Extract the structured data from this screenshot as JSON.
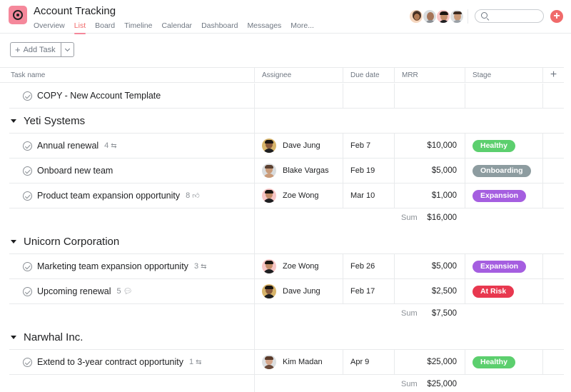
{
  "project": {
    "title": "Account Tracking",
    "icon": "target-icon",
    "brand_color": "#f5889b"
  },
  "tabs": [
    {
      "label": "Overview",
      "active": false
    },
    {
      "label": "List",
      "active": true
    },
    {
      "label": "Board",
      "active": false
    },
    {
      "label": "Timeline",
      "active": false
    },
    {
      "label": "Calendar",
      "active": false
    },
    {
      "label": "Dashboard",
      "active": false
    },
    {
      "label": "Messages",
      "active": false
    },
    {
      "label": "More...",
      "active": false
    }
  ],
  "header": {
    "members": [
      "member-1",
      "member-2",
      "member-3",
      "member-4"
    ],
    "search_placeholder": "",
    "add_icon": "plus-icon"
  },
  "toolbar": {
    "add_task_label": "Add Task",
    "add_task_icon": "+"
  },
  "columns": {
    "task_name": "Task name",
    "assignee": "Assignee",
    "due_date": "Due date",
    "mrr": "MRR",
    "stage": "Stage",
    "add_column": "+"
  },
  "template_task": {
    "name": "COPY - New Account Template"
  },
  "stage_colors": {
    "Healthy": "#5ccf6e",
    "Onboarding": "#8d9ca0",
    "Expansion": "#a55ee0",
    "At Risk": "#e8384f"
  },
  "sections": [
    {
      "name": "Yeti Systems",
      "tasks": [
        {
          "name": "Annual renewal",
          "meta_count": "4",
          "meta_icon": "subtask-icon",
          "assignee": "Dave Jung",
          "due": "Feb 7",
          "mrr": "$10,000",
          "stage": "Healthy"
        },
        {
          "name": "Onboard new team",
          "meta_count": "",
          "meta_icon": "",
          "assignee": "Blake Vargas",
          "due": "Feb 19",
          "mrr": "$5,000",
          "stage": "Onboarding"
        },
        {
          "name": "Product team expansion opportunity",
          "meta_count": "8",
          "meta_icon": "like-icon",
          "assignee": "Zoe Wong",
          "due": "Mar 10",
          "mrr": "$1,000",
          "stage": "Expansion"
        }
      ],
      "sum_label": "Sum",
      "sum": "$16,000"
    },
    {
      "name": "Unicorn Corporation",
      "tasks": [
        {
          "name": "Marketing team expansion opportunity",
          "meta_count": "3",
          "meta_icon": "subtask-icon",
          "assignee": "Zoe Wong",
          "due": "Feb 26",
          "mrr": "$5,000",
          "stage": "Expansion"
        },
        {
          "name": "Upcoming renewal",
          "meta_count": "5",
          "meta_icon": "comment-icon",
          "assignee": "Dave Jung",
          "due": "Feb 17",
          "mrr": "$2,500",
          "stage": "At Risk"
        }
      ],
      "sum_label": "Sum",
      "sum": "$7,500"
    },
    {
      "name": "Narwhal Inc.",
      "tasks": [
        {
          "name": "Extend to 3-year contract opportunity",
          "meta_count": "1",
          "meta_icon": "subtask-icon",
          "assignee": "Kim Madan",
          "due": "Apr 9",
          "mrr": "$25,000",
          "stage": "Healthy"
        }
      ],
      "sum_label": "Sum",
      "sum": "$25,000"
    }
  ]
}
